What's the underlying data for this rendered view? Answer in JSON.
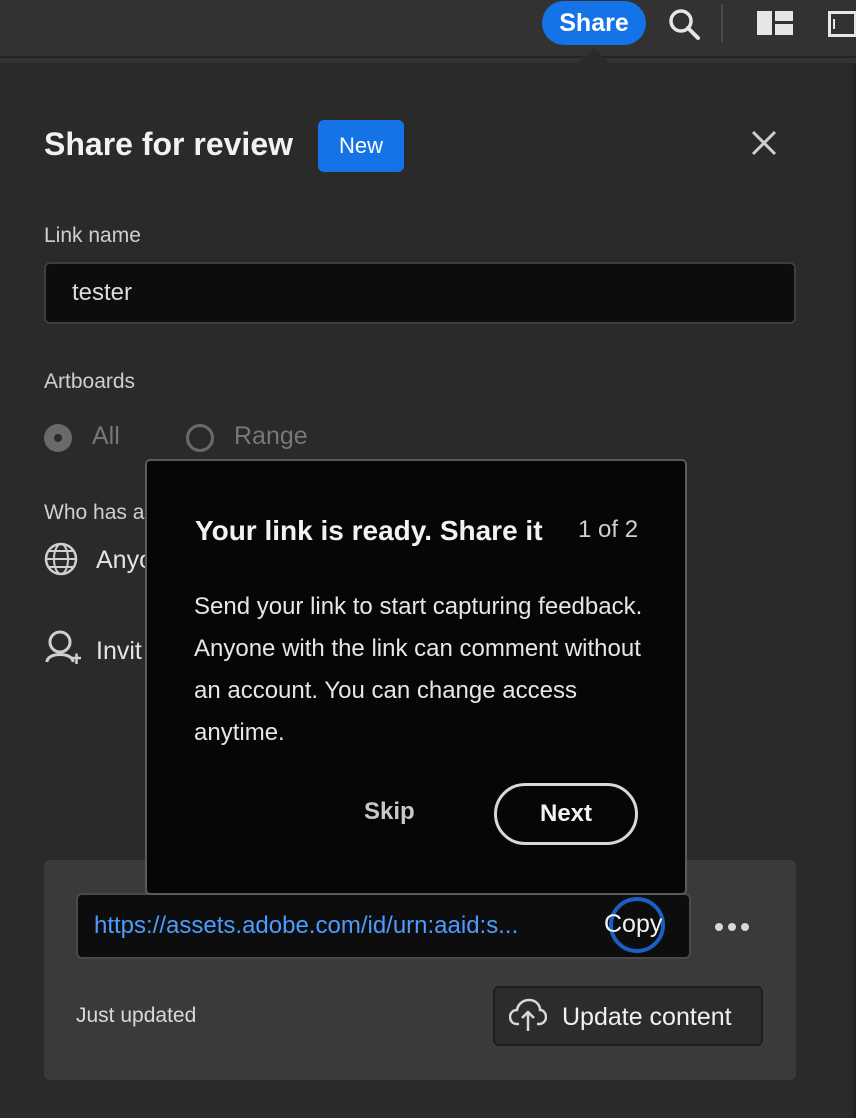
{
  "topbar": {
    "share_label": "Share",
    "icons": [
      "search-icon",
      "layout-icon",
      "panel-icon"
    ]
  },
  "dialog": {
    "title": "Share for review",
    "badge": "New",
    "link_name_label": "Link name",
    "link_name_value": "tester",
    "artboards_label": "Artboards",
    "artboard_options": [
      {
        "label": "All",
        "selected": true
      },
      {
        "label": "Range",
        "selected": false
      }
    ],
    "access_label": "Who has a",
    "access_value": "Anyo",
    "invite_label": "Invit"
  },
  "link": {
    "url": "https://assets.adobe.com/id/urn:aaid:s...",
    "copy_label": "Copy",
    "status": "Just updated",
    "update_label": "Update content"
  },
  "coachmark": {
    "title": "Your link is ready. Share it",
    "step": "1 of 2",
    "body": "Send your link to start capturing feedback. Anyone with the link can comment without an account. You can change access anytime.",
    "skip_label": "Skip",
    "next_label": "Next"
  },
  "colors": {
    "accent": "#1473e6",
    "link": "#4b9cff",
    "panel": "#2a2a2a"
  }
}
